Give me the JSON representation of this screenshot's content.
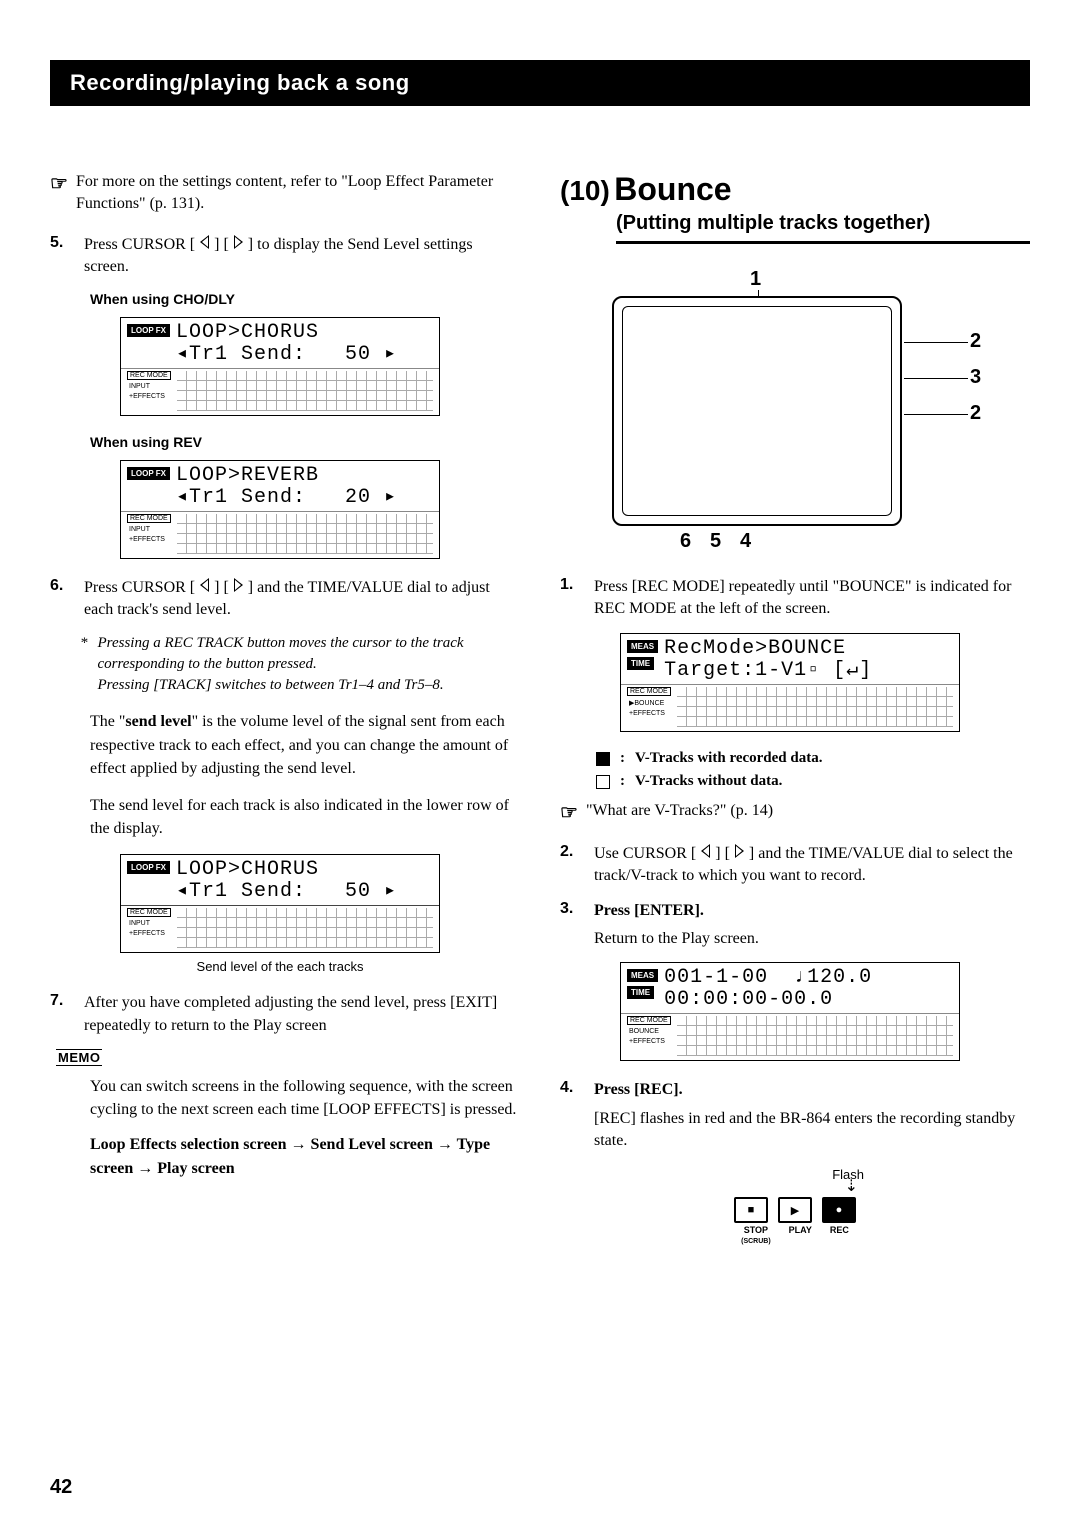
{
  "header": "Recording/playing back a song",
  "left": {
    "ref1": "For more on the settings content, refer to \"Loop Effect Parameter Functions\" (p. 131).",
    "step5": "Press CURSOR [ ◁ ] [ ▷ ] to display the Send Level settings screen.",
    "sub_cho": "When using CHO/DLY",
    "lcd1_line1": "LOOP>CHORUS",
    "lcd1_line2": "◂Tr1 Send:   50 ▸",
    "lcd_loopfx": "LOOP FX",
    "lcd_recmode": "REC MODE",
    "lcd_input": "INPUT",
    "lcd_effects": "+EFFECTS",
    "sub_rev": "When using REV",
    "lcd2_line1": "LOOP>REVERB",
    "lcd2_line2": "◂Tr1 Send:   20 ▸",
    "step6": "Press CURSOR [ ◁ ] [ ▷ ] and the TIME/VALUE dial to adjust each track's send level.",
    "note6a": "Pressing a REC TRACK button moves the cursor to the track corresponding to the button pressed.",
    "note6b": "Pressing [TRACK] switches to between Tr1–4 and Tr5–8.",
    "para1a": "The \"",
    "sendlevel": "send level",
    "para1b": "\" is the volume level of the signal sent from each respective track to each effect, and you can change the amount of effect applied by adjusting the send level.",
    "para2": "The send level for each track is also indicated in the lower row of the display.",
    "lcd3_line1": "LOOP>CHORUS",
    "lcd3_line2": "◂Tr1 Send:   50 ▸",
    "lcd3_caption": "Send level of the each tracks",
    "step7": "After you have completed adjusting the send level, press [EXIT] repeatedly to return to the Play screen",
    "memo": "MEMO",
    "memo_text": "You can switch screens in the following sequence, with the screen cycling to the next screen each time [LOOP EFFECTS] is pressed.",
    "memo_seq": "Loop Effects selection screen  →  Send Level screen  →  Type screen  →  Play screen"
  },
  "right": {
    "sec_num": "(10)",
    "sec_name": "Bounce",
    "sec_sub": "(Putting multiple tracks together)",
    "callout1": "1",
    "callout2a": "2",
    "callout3": "3",
    "callout2b": "2",
    "callout6": "6",
    "callout5": "5",
    "callout4": "4",
    "step1": "Press [REC MODE] repeatedly until \"BOUNCE\" is indicated for REC MODE at the left of the screen.",
    "lcd_meas": "MEAS",
    "lcd_time": "TIME",
    "lcdA_line1": "RecMode>BOUNCE",
    "lcdA_line2": "Target:1-V1▫ [↵]",
    "lcdA_side_recmode": "REC MODE",
    "lcdA_side_bounce": "BOUNCE",
    "lcdA_side_effects": "+EFFECTS",
    "legend_filled": "V-Tracks with recorded data.",
    "legend_open": "V-Tracks without data.",
    "ref2": "\"What are V-Tracks?\" (p. 14)",
    "step2": "Use CURSOR [ ◁ ] [ ▷ ] and the TIME/VALUE dial to select the track/V-track to which you want to record.",
    "step3": "Press [ENTER].",
    "step3_sub": "Return to the Play screen.",
    "lcdB_line1": "001-1-00  ♩120.0",
    "lcdB_line2": "00:00:00-00.0",
    "step4": "Press [REC].",
    "step4_sub": "[REC] flashes in red and the BR-864 enters the recording standby state.",
    "flash_label": "Flash",
    "btn_stop": "■",
    "btn_stop_sub": "STOP\n(SCRUB)",
    "btn_play": "▶",
    "btn_play_sub": "PLAY",
    "btn_rec": "●",
    "btn_rec_sub": "REC"
  },
  "page_number": "42"
}
